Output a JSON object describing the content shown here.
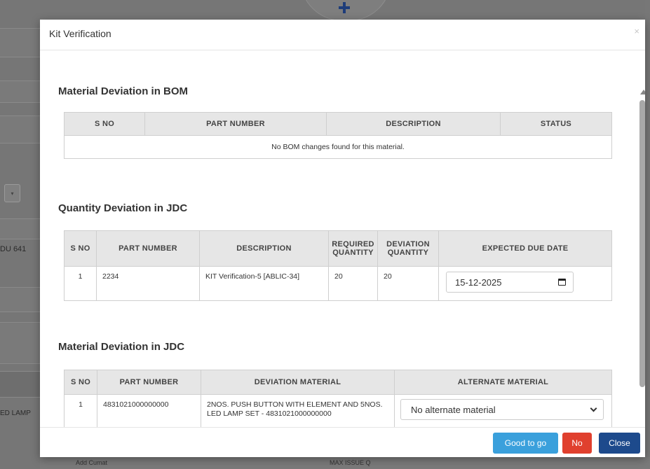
{
  "background": {
    "left_labels": [
      "DU 641",
      "ED LAMP"
    ],
    "bottom_labels": [
      "Add Cumat",
      "MAX ISSUE Q"
    ]
  },
  "modal": {
    "title": "Kit Verification",
    "close_symbol": "×"
  },
  "bom_section": {
    "title": "Material Deviation in BOM",
    "headers": [
      "S NO",
      "PART NUMBER",
      "DESCRIPTION",
      "STATUS"
    ],
    "empty_message": "No BOM changes found for this material."
  },
  "qty_section": {
    "title": "Quantity Deviation in JDC",
    "headers": [
      "S NO",
      "PART NUMBER",
      "DESCRIPTION",
      "REQUIRED QUANTITY",
      "DEVIATION QUANTITY",
      "EXPECTED DUE DATE"
    ],
    "rows": [
      {
        "sno": "1",
        "part_number": "2234",
        "description": "KIT Verification-5 [ABLIC-34]",
        "required_qty": "20",
        "deviation_qty": "20",
        "due_date": "15-12-2025"
      }
    ]
  },
  "material_section": {
    "title": "Material Deviation in JDC",
    "headers": [
      "S NO",
      "PART NUMBER",
      "DEVIATION MATERIAL",
      "ALTERNATE MATERIAL"
    ],
    "rows": [
      {
        "sno": "1",
        "part_number": "4831021000000000",
        "deviation_material": "2NOS. PUSH BUTTON WITH ELEMENT AND 5NOS. LED LAMP SET - 4831021000000000",
        "alternate_material": "No alternate material"
      }
    ]
  },
  "footer": {
    "good_label": "Good to go",
    "no_label": "No",
    "close_label": "Close"
  },
  "colors": {
    "good": "#3aa0dc",
    "no": "#e0402e",
    "close": "#1d4a8c"
  }
}
